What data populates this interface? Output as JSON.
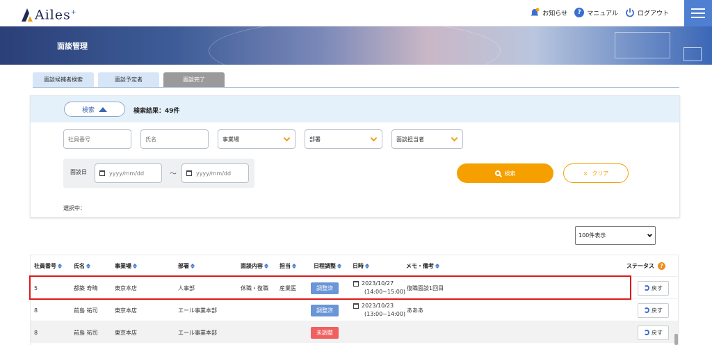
{
  "app": {
    "logo_text": "Ailes",
    "logo_sup": "+"
  },
  "header": {
    "notice": "お知らせ",
    "manual": "マニュアル",
    "logout": "ログアウト",
    "manual_icon_glyph": "?"
  },
  "banner": {
    "title": "面談管理"
  },
  "tabs": [
    {
      "label": "面談候補者検索",
      "active": false
    },
    {
      "label": "面談予定者",
      "active": false
    },
    {
      "label": "面談完了",
      "active": true
    }
  ],
  "search": {
    "toggle_label": "検索",
    "result_text": "検索結果：49件",
    "employee_no_placeholder": "社員番号",
    "name_placeholder": "氏名",
    "office_select": "事業場",
    "dept_select": "部署",
    "staff_select": "面談担当者",
    "date_label": "面談日",
    "date_from_placeholder": "yyyy/mm/dd",
    "date_to_placeholder": "yyyy/mm/dd",
    "tilde": "～",
    "search_button": "検索",
    "clear_button": "クリア",
    "clear_icon": "×",
    "selected_label": "選択中："
  },
  "pagination": {
    "per_page": "100件表示"
  },
  "table": {
    "headers": {
      "emp_no": "社員番号",
      "name": "氏名",
      "office": "事業場",
      "dept": "部署",
      "content": "面談内容",
      "staff": "担当",
      "schedule": "日程調整",
      "datetime": "日時",
      "memo": "メモ・備考",
      "status": "ステータス",
      "help_glyph": "?"
    },
    "rows": [
      {
        "emp_no": "5",
        "name": "都築 寿晴",
        "office": "東京本店",
        "dept": "人事部",
        "content": "休職・復職",
        "staff": "産業医",
        "schedule": "調整済",
        "date": "2023/10/27",
        "time": "(14:00~15:00)",
        "memo": "復職面談1回目",
        "action": "戻す"
      },
      {
        "emp_no": "8",
        "name": "前島 祐司",
        "office": "東京本店",
        "dept": "エール事業本部",
        "content": "",
        "staff": "",
        "schedule": "調整済",
        "date": "2023/10/23",
        "time": "(13:00~14:00)",
        "memo": "あああ",
        "action": "戻す"
      },
      {
        "emp_no": "8",
        "name": "前島 祐司",
        "office": "東京本店",
        "dept": "エール事業本部",
        "content": "",
        "staff": "",
        "schedule": "未調整",
        "date": "",
        "time": "",
        "memo": "",
        "action": "戻す"
      }
    ]
  },
  "colors": {
    "accent": "#f5a000",
    "primary": "#3c6ed2",
    "done_badge": "#6a95d6",
    "todo_badge": "#f06060",
    "highlight": "#e01818"
  }
}
